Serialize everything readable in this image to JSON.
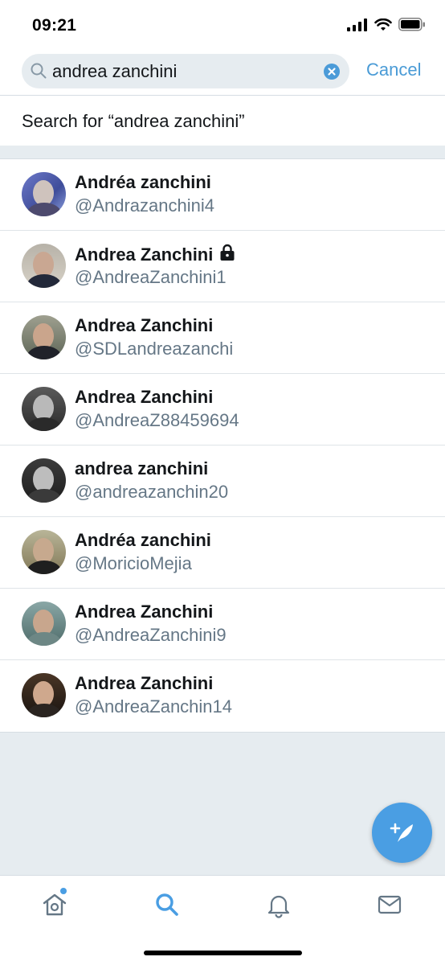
{
  "status_bar": {
    "time": "09:21"
  },
  "search": {
    "query": "andrea zanchini",
    "cancel_label": "Cancel"
  },
  "search_for": {
    "label": "Search for “andrea zanchini”"
  },
  "results": [
    {
      "name": "Andréa zanchini",
      "handle": "@Andrazanchini4",
      "locked": false
    },
    {
      "name": "Andrea Zanchini",
      "handle": "@AndreaZanchini1",
      "locked": true
    },
    {
      "name": "Andrea Zanchini",
      "handle": "@SDLandreazanchi",
      "locked": false
    },
    {
      "name": "Andrea Zanchini",
      "handle": "@AndreaZ88459694",
      "locked": false
    },
    {
      "name": "andrea zanchini",
      "handle": "@andreazanchin20",
      "locked": false
    },
    {
      "name": "Andréa zanchini",
      "handle": "@MoricioMejia",
      "locked": false
    },
    {
      "name": "Andrea Zanchini",
      "handle": "@AndreaZanchini9",
      "locked": false
    },
    {
      "name": "Andrea Zanchini",
      "handle": "@AndreaZanchin14",
      "locked": false
    }
  ],
  "icons": {
    "signal": "signal-icon",
    "wifi": "wifi-icon",
    "battery": "battery-icon",
    "search": "search-icon",
    "clear": "clear-icon",
    "lock": "lock-icon",
    "compose": "compose-tweet-icon",
    "home": "home-icon",
    "explore": "search-tab-icon",
    "notifications": "bell-icon",
    "messages": "mail-icon"
  },
  "colors": {
    "accent": "#4a9bd6",
    "secondary_text": "#657786",
    "background": "#e6ecf0"
  },
  "tabs": [
    {
      "name": "home",
      "active": false,
      "has_notification_dot": true
    },
    {
      "name": "search",
      "active": true
    },
    {
      "name": "notifications",
      "active": false
    },
    {
      "name": "messages",
      "active": false
    }
  ]
}
